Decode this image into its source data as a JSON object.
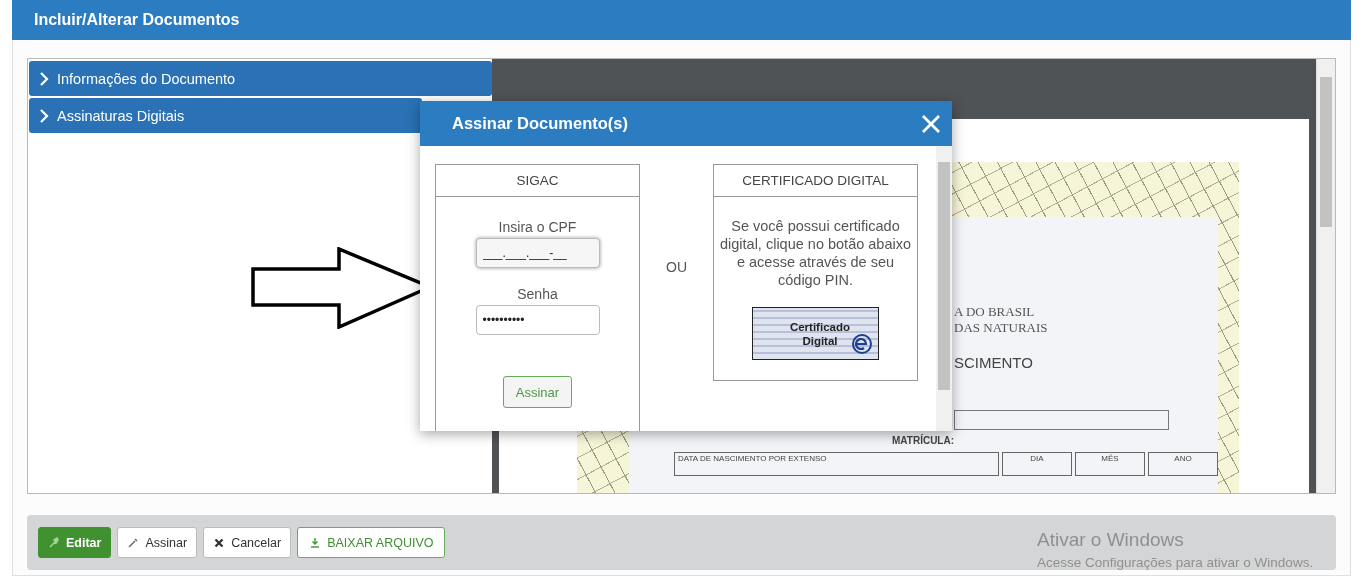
{
  "page": {
    "title": "Incluir/Alterar Documentos"
  },
  "accordion": [
    {
      "label": "Informações do Documento",
      "expanded": false
    },
    {
      "label": "Assinaturas Digitais",
      "expanded": false
    }
  ],
  "document_preview": {
    "lines": [
      "A DO BRASIL",
      "DAS NATURAIS"
    ],
    "heading": "SCIMENTO",
    "field_label": "MATRÍCULA:",
    "date_label": "DATA DE NASCIMENTO POR EXTENSO",
    "date_parts": [
      "DIA",
      "MÊS",
      "ANO"
    ]
  },
  "modal": {
    "title": "Assinar Documento(s)",
    "sigac": {
      "title": "SIGAC",
      "cpf_label": "Insira o CPF",
      "cpf_value": "___.___.___-__",
      "cpf_focused": true,
      "password_label": "Senha",
      "password_value": "••••••••••",
      "button": "Assinar"
    },
    "separator": "OU",
    "certificate": {
      "title": "CERTIFICADO DIGITAL",
      "text": "Se você possui certificado digital, clique no botão abaixo e acesse através de seu código PIN.",
      "button_lines": [
        "Certificado",
        "Digital"
      ]
    }
  },
  "toolbar": [
    {
      "label": "Editar",
      "kind": "primary"
    },
    {
      "label": "Assinar",
      "kind": "default"
    },
    {
      "label": "Cancelar",
      "kind": "default"
    },
    {
      "label": "BAIXAR ARQUIVO",
      "kind": "outline"
    }
  ],
  "windows_notice": {
    "title": "Ativar o Windows",
    "text": "Acesse Configurações para ativar o Windows."
  }
}
